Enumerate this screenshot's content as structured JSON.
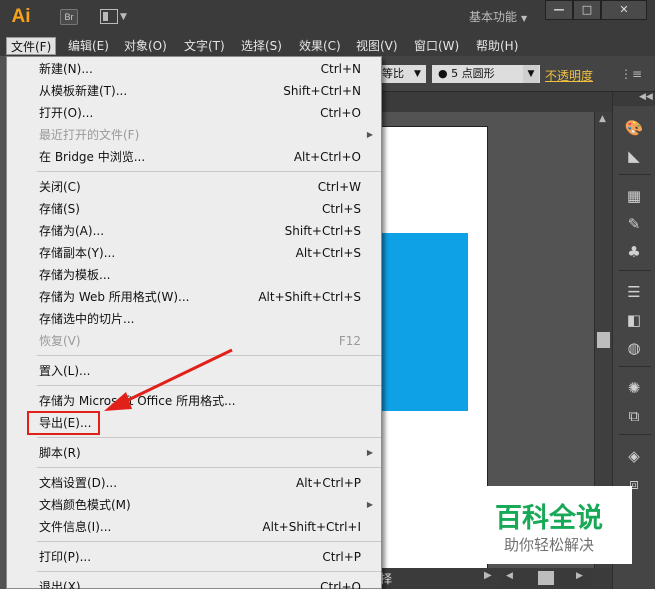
{
  "app": {
    "logo": "Ai",
    "bridge_label": "Br",
    "workspace_label": "基本功能"
  },
  "window_controls": {
    "minimize": "—",
    "maximize": "□",
    "close": "✕"
  },
  "menubar": [
    {
      "label": "文件(F)",
      "active": true
    },
    {
      "label": "编辑(E)"
    },
    {
      "label": "对象(O)"
    },
    {
      "label": "文字(T)"
    },
    {
      "label": "选择(S)"
    },
    {
      "label": "效果(C)"
    },
    {
      "label": "视图(V)"
    },
    {
      "label": "窗口(W)"
    },
    {
      "label": "帮助(H)"
    }
  ],
  "controlbar": {
    "ratio": "等比",
    "brush": "● 5 点圆形",
    "opacity_label": "不透明度"
  },
  "status": {
    "label": "择"
  },
  "file_menu": [
    {
      "label": "新建(N)...",
      "shortcut": "Ctrl+N"
    },
    {
      "label": "从模板新建(T)...",
      "shortcut": "Shift+Ctrl+N"
    },
    {
      "label": "打开(O)...",
      "shortcut": "Ctrl+O"
    },
    {
      "label": "最近打开的文件(F)",
      "shortcut": "",
      "submenu": true,
      "disabled": true
    },
    {
      "label": "在 Bridge 中浏览...",
      "shortcut": "Alt+Ctrl+O"
    },
    {
      "sep": true
    },
    {
      "label": "关闭(C)",
      "shortcut": "Ctrl+W"
    },
    {
      "label": "存储(S)",
      "shortcut": "Ctrl+S"
    },
    {
      "label": "存储为(A)...",
      "shortcut": "Shift+Ctrl+S"
    },
    {
      "label": "存储副本(Y)...",
      "shortcut": "Alt+Ctrl+S"
    },
    {
      "label": "存储为模板...",
      "shortcut": ""
    },
    {
      "label": "存储为 Web 所用格式(W)...",
      "shortcut": "Alt+Shift+Ctrl+S"
    },
    {
      "label": "存储选中的切片...",
      "shortcut": ""
    },
    {
      "label": "恢复(V)",
      "shortcut": "F12",
      "disabled": true
    },
    {
      "sep": true
    },
    {
      "label": "置入(L)...",
      "shortcut": ""
    },
    {
      "sep": true
    },
    {
      "label": "存储为 Microsoft Office 所用格式...",
      "shortcut": ""
    },
    {
      "label": "导出(E)...",
      "shortcut": "",
      "highlight": true
    },
    {
      "sep": true
    },
    {
      "label": "脚本(R)",
      "shortcut": "",
      "submenu": true
    },
    {
      "sep": true
    },
    {
      "label": "文档设置(D)...",
      "shortcut": "Alt+Ctrl+P"
    },
    {
      "label": "文档颜色模式(M)",
      "shortcut": "",
      "submenu": true
    },
    {
      "label": "文件信息(I)...",
      "shortcut": "Alt+Shift+Ctrl+I"
    },
    {
      "sep": true
    },
    {
      "label": "打印(P)...",
      "shortcut": "Ctrl+P"
    },
    {
      "sep": true
    },
    {
      "label": "退出(X)",
      "shortcut": "Ctrl+Q"
    }
  ],
  "dock_icons": [
    "palette-icon",
    "gradient-icon",
    "grid-icon",
    "brush-icon",
    "club-icon",
    "lines-icon",
    "gradient-swatch-icon",
    "circles-icon",
    "sun-icon",
    "export-icon",
    "layers-icon",
    "artboards-icon"
  ],
  "watermark": {
    "title": "百科全说",
    "subtitle": "助你轻松解决"
  },
  "colors": {
    "accent_blue": "#0ea1e6",
    "highlight_red": "#e1201a",
    "watermark_green": "#18a957",
    "logo_orange": "#f7a21b"
  }
}
